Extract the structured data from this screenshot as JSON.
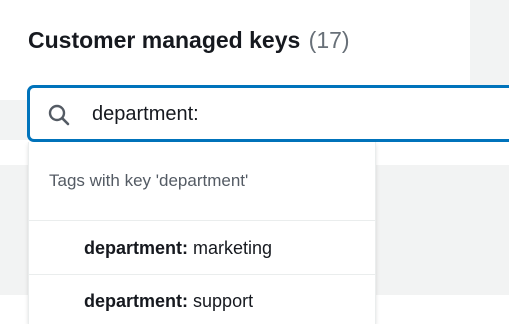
{
  "header": {
    "title": "Customer managed keys",
    "count": "(17)"
  },
  "search": {
    "icon": "search-icon",
    "value": "department:"
  },
  "dropdown": {
    "group_label": "Tags with key 'department'",
    "options": [
      {
        "key": "department:",
        "value": "marketing"
      },
      {
        "key": "department:",
        "value": "support"
      }
    ]
  },
  "colors": {
    "accent": "#0073bb",
    "text": "#16191f",
    "muted": "#687078",
    "background": "#f2f3f3"
  }
}
